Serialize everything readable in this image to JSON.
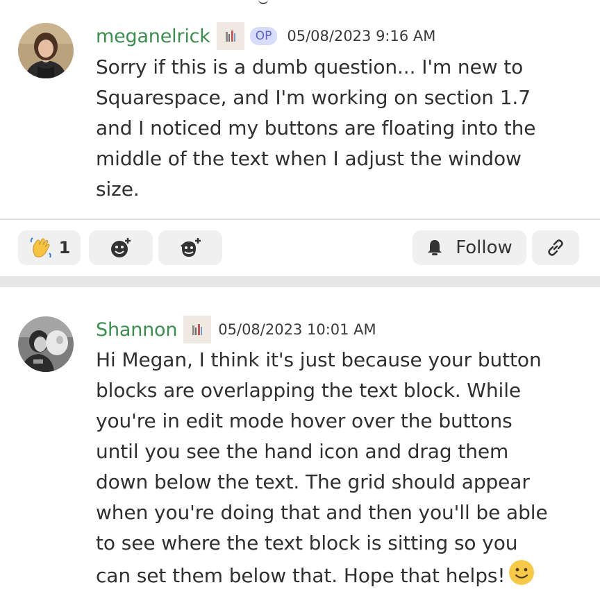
{
  "posts": [
    {
      "username": "meganelrick",
      "op_badge": "OP",
      "timestamp": "05/08/2023 9:16 AM",
      "avatar_icon": "avatar-photo",
      "badge_icon": "user-badge-icon",
      "body_lines": [
        "Sorry if this is a dumb question... I'm new to",
        "Squarespace, and I'm working on section 1.7",
        "and I noticed my buttons are floating into the",
        "middle of the text when I adjust the window",
        "size."
      ]
    },
    {
      "username": "Shannon",
      "timestamp": "05/08/2023 10:01 AM",
      "avatar_icon": "avatar-photo",
      "badge_icon": "user-badge-icon",
      "body_lines": [
        "Hi Megan, I think it's just because your button",
        "blocks are overlapping  the text block. While",
        "you're in edit mode hover over the buttons",
        "until you see the hand icon and drag them",
        "down below the text. The grid should appear",
        "when you're doing that and then you'll be able",
        "to see where the text block is sitting so you",
        "can set them below that. Hope that helps!"
      ],
      "trailing_emoji": "slightly-smiling-face"
    }
  ],
  "actions": {
    "reaction_emoji": "waving-hand",
    "reaction_count": "1",
    "add_reaction_icon": "add-reaction-icon",
    "add_super_reaction_icon": "add-super-reaction-icon",
    "follow_label": "Follow",
    "follow_icon": "bell-icon",
    "copy_link_icon": "link-icon"
  },
  "colors": {
    "username": "#3c8d4f",
    "op_badge_bg": "#d7dcfb",
    "op_badge_text": "#5a62c8",
    "button_bg": "#f0f0f0",
    "divider": "#e6e6e6"
  }
}
